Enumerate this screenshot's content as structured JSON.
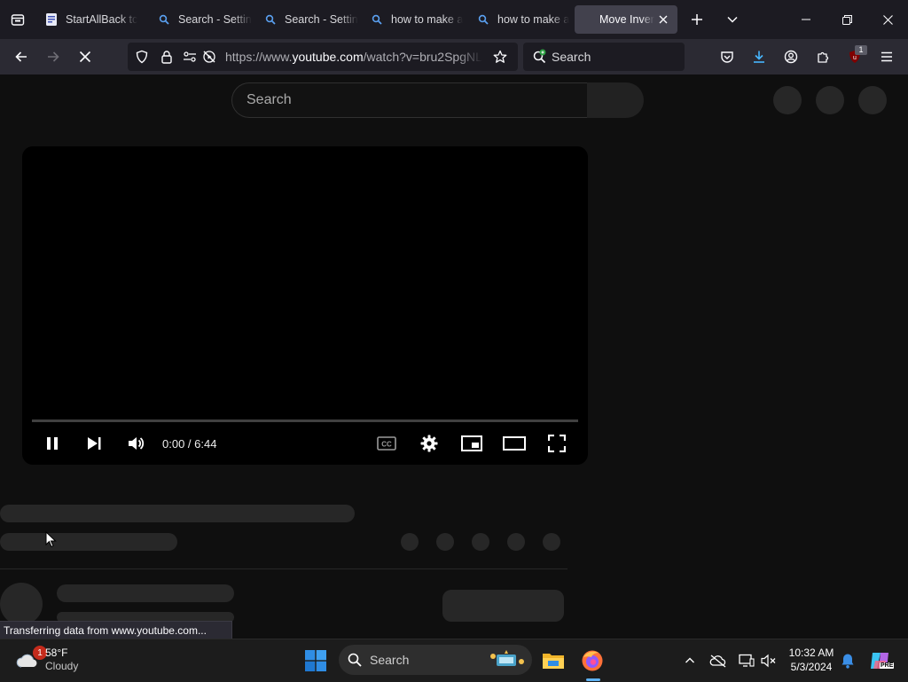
{
  "browser": {
    "tabs": [
      {
        "label": "StartAllBack tc",
        "icon": "startallback-icon"
      },
      {
        "label": "Search - Settin",
        "icon": "search-favicon"
      },
      {
        "label": "Search - Settin",
        "icon": "search-favicon"
      },
      {
        "label": "how to make a",
        "icon": "search-favicon"
      },
      {
        "label": "how to make a",
        "icon": "search-favicon"
      },
      {
        "label": "Move Inver",
        "icon": "loading-icon",
        "active": true
      }
    ],
    "url": {
      "prefix": "https://www.",
      "host": "youtube.com",
      "path": "/watch?v=bru2SpgNL"
    },
    "search_placeholder": "Search",
    "extension_badge": "1"
  },
  "youtube": {
    "search_placeholder": "Search",
    "player": {
      "time": "0:00 / 6:44",
      "state": "playing",
      "progress": 0
    }
  },
  "status_text": "Transferring data from www.youtube.com...",
  "taskbar": {
    "weather": {
      "temperature": "58°F",
      "condition": "Cloudy",
      "badge": "1"
    },
    "search_placeholder": "Search",
    "clock": {
      "time": "10:32 AM",
      "date": "5/3/2024"
    },
    "copilot_label": "PRE"
  },
  "colors": {
    "accent_blue": "#0078d4",
    "firefox_orange": "#ff7139",
    "notification_red": "#c42b1c"
  }
}
